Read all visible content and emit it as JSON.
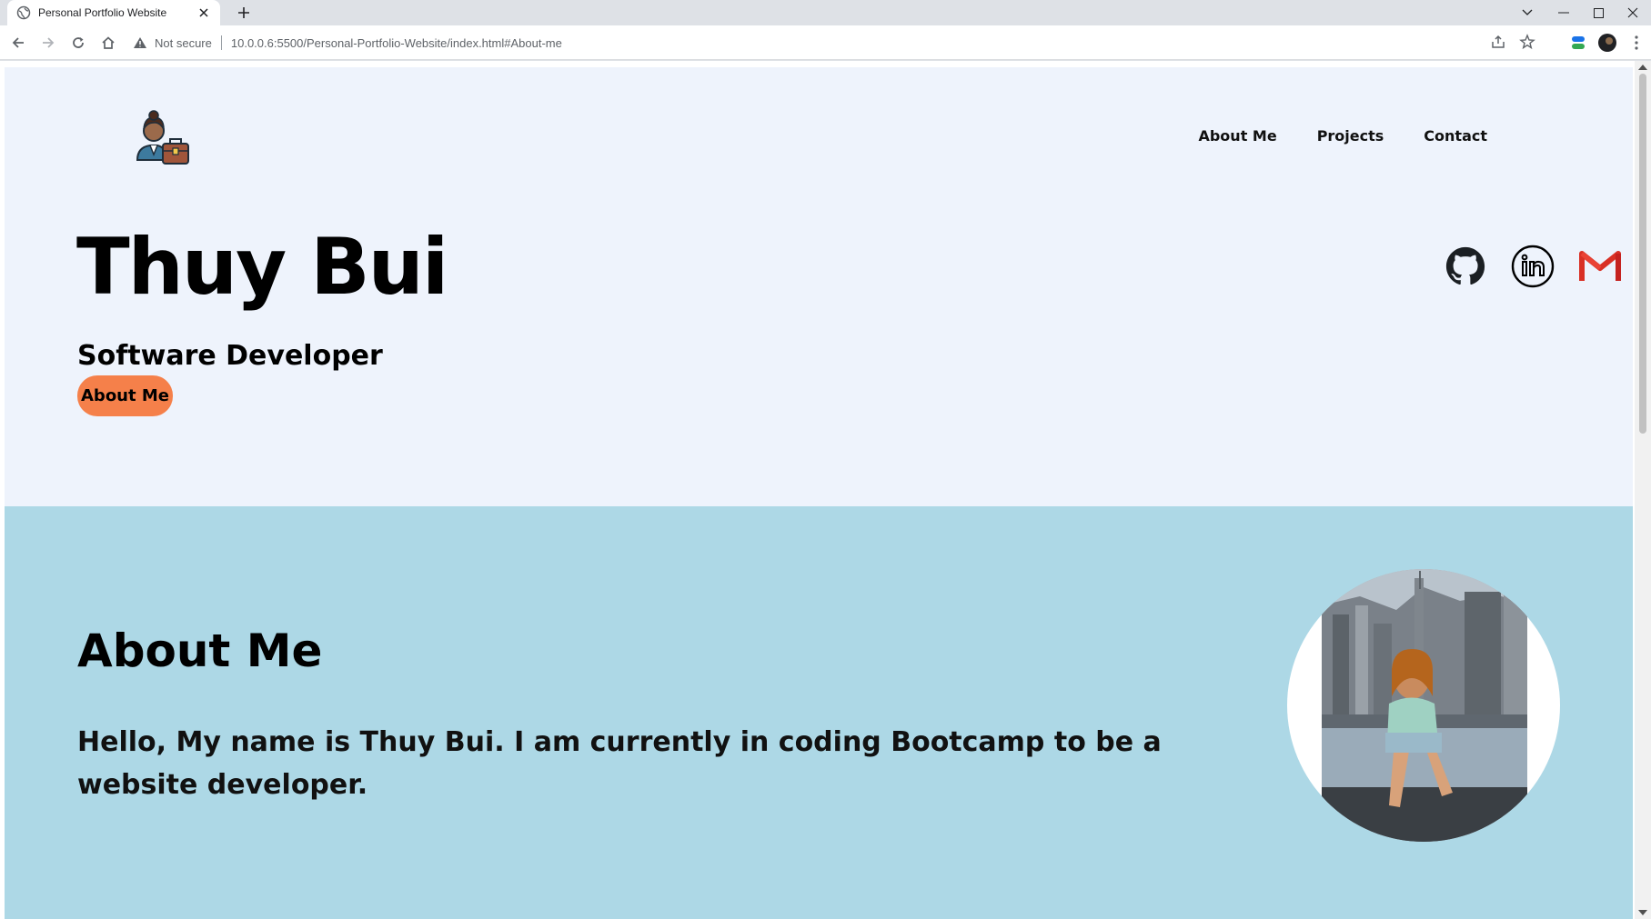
{
  "browser": {
    "tab_title": "Personal Portfolio Website",
    "security_label": "Not secure",
    "url": "10.0.0.6:5500/Personal-Portfolio-Website/index.html#About-me"
  },
  "nav": {
    "items": [
      {
        "label": "About Me"
      },
      {
        "label": "Projects"
      },
      {
        "label": "Contact"
      }
    ]
  },
  "hero": {
    "name": "Thuy Bui",
    "role": "Software Developer",
    "cta_label": "About Me",
    "social_icons": [
      "github-icon",
      "linkedin-icon",
      "gmail-icon"
    ]
  },
  "about": {
    "title": "About Me",
    "text": "Hello, My name is Thuy Bui. I am currently in coding Bootcamp to be a website developer."
  },
  "colors": {
    "hero_bg": "#eef3fc",
    "about_bg": "#add8e6",
    "cta_bg": "#f5804a",
    "gmail_red": "#d93025"
  }
}
